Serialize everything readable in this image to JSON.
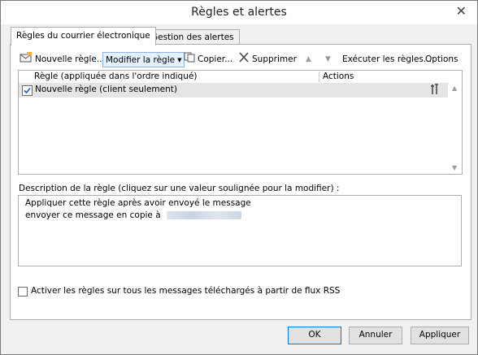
{
  "window": {
    "title": "Règles et alertes",
    "close_glyph": "✕"
  },
  "tabs": [
    {
      "label": "Règles du courrier électronique",
      "active": true
    },
    {
      "label": "Gestion des alertes",
      "active": false
    }
  ],
  "toolbar": {
    "new_rule": "Nouvelle règle...",
    "modify_rule": "Modifier la règle",
    "copy": "Copier...",
    "delete": "Supprimer",
    "run_rules": "Exécuter les règles...",
    "options": "Options"
  },
  "rules_table": {
    "columns": [
      "Règle (appliquée dans l'ordre indiqué)",
      "Actions"
    ],
    "rows": [
      {
        "checked": true,
        "label": "Nouvelle règle  (client seulement)"
      }
    ]
  },
  "description": {
    "label": "Description de la règle (cliquez sur une valeur soulignée pour la modifier) :",
    "lines": [
      "Appliquer cette règle après avoir envoyé le message",
      "envoyer ce message en copie à"
    ]
  },
  "rss": {
    "checked": false,
    "label": "Activer les règles sur tous les messages téléchargés à partir de flux RSS"
  },
  "buttons": {
    "ok": "OK",
    "cancel": "Annuler",
    "apply": "Appliquer"
  },
  "icons": {
    "new_rule": "new-rule-icon",
    "copy": "copy-icon",
    "delete": "delete-icon",
    "move_up": "arrow-up-icon",
    "move_down": "arrow-down-icon",
    "actions": "tools-icon",
    "check": "checkmark-icon"
  },
  "colors": {
    "accent_blue": "#0078d7",
    "selected_row": "#e5e5e5"
  }
}
